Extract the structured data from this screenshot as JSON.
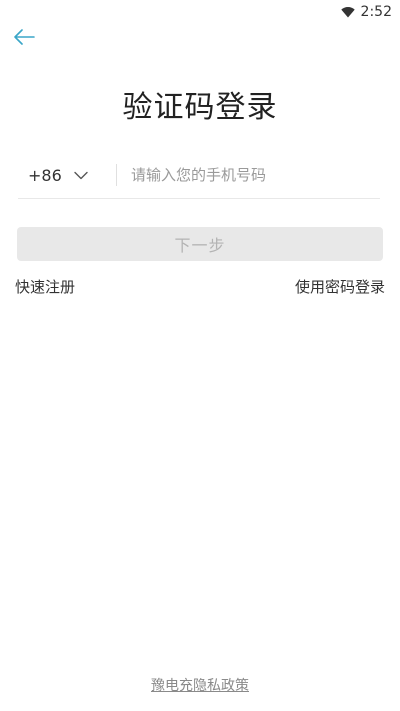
{
  "status_bar": {
    "time": "2:52",
    "icons": [
      "wifi-icon"
    ]
  },
  "header": {
    "back_icon": "arrow-left-icon",
    "accent_color": "#3aa6c8"
  },
  "page": {
    "title": "验证码登录"
  },
  "phone_form": {
    "country_code": "+86",
    "country_dropdown_icon": "chevron-down-icon",
    "phone_placeholder": "请输入您的手机号码",
    "phone_value": ""
  },
  "actions": {
    "next_label": "下一步",
    "next_enabled": false,
    "register_label": "快速注册",
    "password_login_label": "使用密码登录"
  },
  "footer": {
    "privacy_label": "豫电充隐私政策"
  }
}
